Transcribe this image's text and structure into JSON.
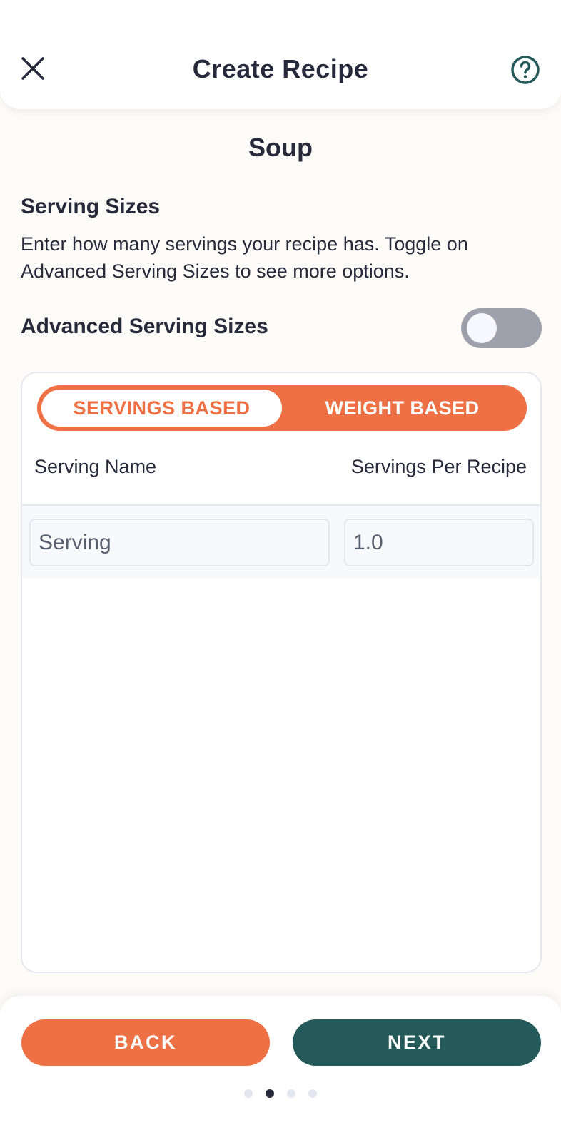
{
  "header": {
    "title": "Create Recipe",
    "close_icon": "close-icon",
    "help_icon": "help-circle-icon"
  },
  "recipe": {
    "name": "Soup"
  },
  "serving_sizes": {
    "title": "Serving Sizes",
    "description": "Enter how many servings your recipe has. Toggle on Advanced Serving Sizes to see more options.",
    "advanced_label": "Advanced Serving Sizes",
    "advanced_enabled": false
  },
  "mode_selector": {
    "options": [
      {
        "label": "SERVINGS BASED",
        "active": true
      },
      {
        "label": "WEIGHT BASED",
        "active": false
      }
    ]
  },
  "table": {
    "columns": [
      "Serving Name",
      "Servings Per Recipe"
    ],
    "rows": [
      {
        "serving_name": "Serving",
        "servings_per_recipe": "1.0"
      }
    ]
  },
  "footer": {
    "back_label": "BACK",
    "next_label": "NEXT",
    "steps_total": 4,
    "current_step": 2
  },
  "colors": {
    "accent_orange": "#ee7045",
    "accent_teal": "#255a5b",
    "text_dark": "#262a3b",
    "toggle_off": "#9ea0ab",
    "background": "#fcfbf7"
  }
}
